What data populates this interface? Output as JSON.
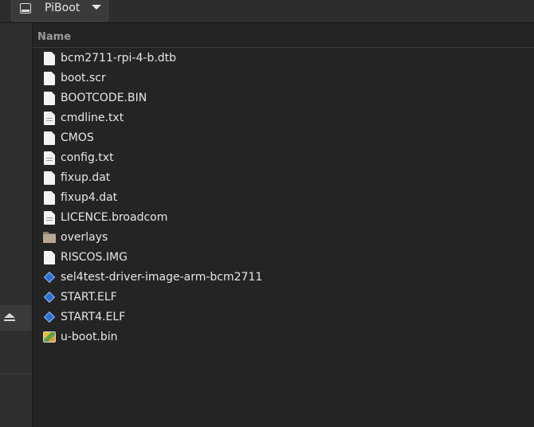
{
  "location": {
    "label": "PiBoot",
    "icon": "drive-icon"
  },
  "sidebar": {
    "eject_icon": "eject-icon"
  },
  "columns": {
    "name": "Name"
  },
  "files": [
    {
      "name": "bcm2711-rpi-4-b.dtb",
      "icon": "file-icon"
    },
    {
      "name": "boot.scr",
      "icon": "file-icon"
    },
    {
      "name": "BOOTCODE.BIN",
      "icon": "file-icon"
    },
    {
      "name": "cmdline.txt",
      "icon": "text-file-icon"
    },
    {
      "name": "CMOS",
      "icon": "file-icon"
    },
    {
      "name": "config.txt",
      "icon": "text-file-icon"
    },
    {
      "name": "fixup.dat",
      "icon": "file-icon"
    },
    {
      "name": "fixup4.dat",
      "icon": "file-icon"
    },
    {
      "name": "LICENCE.broadcom",
      "icon": "text-file-icon"
    },
    {
      "name": "overlays",
      "icon": "folder-icon"
    },
    {
      "name": "RISCOS.IMG",
      "icon": "file-icon"
    },
    {
      "name": "sel4test-driver-image-arm-bcm2711",
      "icon": "executable-icon"
    },
    {
      "name": "START.ELF",
      "icon": "executable-icon"
    },
    {
      "name": "START4.ELF",
      "icon": "executable-icon"
    },
    {
      "name": "u-boot.bin",
      "icon": "binary-image-icon"
    }
  ],
  "colors": {
    "background": "#242424",
    "sidebar": "#2f2f2f",
    "executable_accent": "#2f6fd6"
  }
}
